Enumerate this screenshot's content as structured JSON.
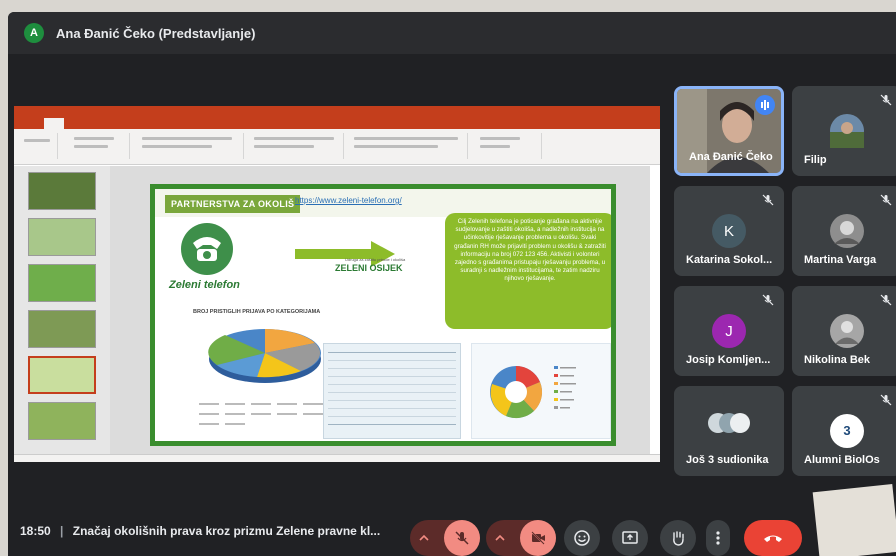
{
  "meeting": {
    "presenter_initial": "A",
    "title": "Ana Đanić Čeko (Predstavljanje)",
    "time": "18:50",
    "separator": "|",
    "meeting_name": "Značaj okolišnih prava kroz prizmu Zelene pravne kl..."
  },
  "slide": {
    "title": "PARTNERSTVA ZA OKOLIŠ",
    "link": "https://www.zeleni-telefon.org/",
    "phone_logo": "Zeleni telefon",
    "org_logo": "ZELENI OSIJEK",
    "org_sub": "Udruga za zaštitu prirode i okoliša",
    "box_text": "Cilj Zelenih telefona je poticanje građana na aktivnije sudjelovanje u zaštiti okoliša, a nadležnih institucija na učinkovitije rješavanje problema u okolišu. Svaki građanin RH može prijaviti problem u okolišu & zatražiti informaciju na broj 072 123 456. Aktivisti i volonteri zajedno s građanima pristupaju rješavanju problema, u suradnji s nadležnim institucijama, te zatim nadziru njihovo rješavanje.",
    "chart_title": "BROJ PRISTIGLIH PRIJAVA PO KATEGORIJAMA"
  },
  "colors": {
    "slide_green": "#3a8d2e",
    "box_green": "#8dbc2a",
    "powerpoint_red": "#c43e1c",
    "leave_red": "#ea4335",
    "muted_red": "#f28b82"
  },
  "participants": [
    {
      "name": "Ana Đanić Čeko",
      "avatar": "video",
      "speaking": true
    },
    {
      "name": "Filip",
      "avatar": "photo",
      "muted": true
    },
    {
      "name": "Katarina Sokol...",
      "initial": "K",
      "color": "#455a64",
      "muted": true
    },
    {
      "name": "Martina Varga",
      "avatar": "photo",
      "muted": true
    },
    {
      "name": "Josip Komljen...",
      "initial": "J",
      "color": "#9c27b0",
      "muted": true
    },
    {
      "name": "Nikolina Bek",
      "avatar": "photo",
      "muted": true
    },
    {
      "name": "Još 3 sudionika",
      "avatar": "group"
    },
    {
      "name": "Alumni BiolOs",
      "avatar": "logo",
      "muted": true
    }
  ],
  "controls": {
    "icons": [
      "chevron-up-icon",
      "mic-off-icon",
      "chevron-up-icon",
      "camera-off-icon",
      "emoji-icon",
      "present-icon",
      "raise-hand-icon",
      "more-icon",
      "leave-call-icon"
    ]
  }
}
